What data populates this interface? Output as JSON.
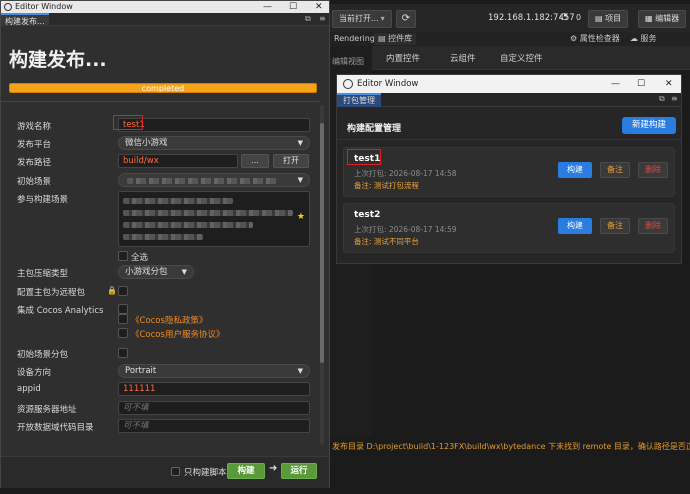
{
  "background": {
    "open_button": "当前打开...",
    "ip": "192.168.1.182:7457",
    "zero": "0",
    "project_button": "项目",
    "editor_button": "编辑器",
    "tabs": [
      "Rendering",
      "控件库",
      "属性检查器",
      "服务"
    ],
    "subtabs": [
      "内置控件",
      "云组件",
      "自定义控件"
    ],
    "left_strip_text": "编辑视图",
    "console_log": "发布目录 D:\\project\\build\\1-123FX\\build\\wx\\bytedance 下未找到 remote 目录，确认路径是否正确  Coc"
  },
  "left_window": {
    "title": "Editor Window",
    "tab": "构建发布...",
    "header": "构建发布...",
    "progress_label": "completed",
    "progress_value": 1.0,
    "fields": {
      "game_name_label": "游戏名称",
      "game_name_value": "test1",
      "platform_label": "发布平台",
      "platform_value": "微信小游戏",
      "path_label": "发布路径",
      "path_value": "build/wx",
      "path_more": "...",
      "path_open": "打开",
      "start_scene_label": "初始场景",
      "scenes_label": "参与构建场景",
      "select_all_label": "全选",
      "compress_label": "主包压缩类型",
      "compress_value": "小游戏分包",
      "remote_label": "配置主包为远程包",
      "analytics_label": "集成 Cocos Analytics",
      "privacy_link": "《Cocos隐私政策》",
      "service_link": "《Cocos用户服务协议》",
      "start_scene_sub_label": "初始场景分包",
      "orientation_label": "设备方向",
      "orientation_value": "Portrait",
      "appid_label": "appid",
      "appid_value": "111111",
      "res_server_label": "资源服务器地址",
      "res_server_placeholder": "可不填",
      "open_data_label": "开放数据域代码目录",
      "open_data_placeholder": "可不填"
    },
    "footer": {
      "build_script_only": "只构建脚本",
      "build": "构建",
      "run": "运行"
    }
  },
  "right_window": {
    "title": "Editor Window",
    "tab": "打包管理",
    "header": "构建配置管理",
    "new_button": "新建构建",
    "configs": [
      {
        "name": "test1",
        "time": "上次打包: 2026-08-17 14:58",
        "note": "备注: 测试打包流程",
        "build": "构建",
        "remark": "备注",
        "delete": "删除"
      },
      {
        "name": "test2",
        "time": "上次打包: 2026-08-17 14:59",
        "note": "备注: 测试不同平台",
        "build": "构建",
        "remark": "备注",
        "delete": "删除"
      }
    ]
  }
}
